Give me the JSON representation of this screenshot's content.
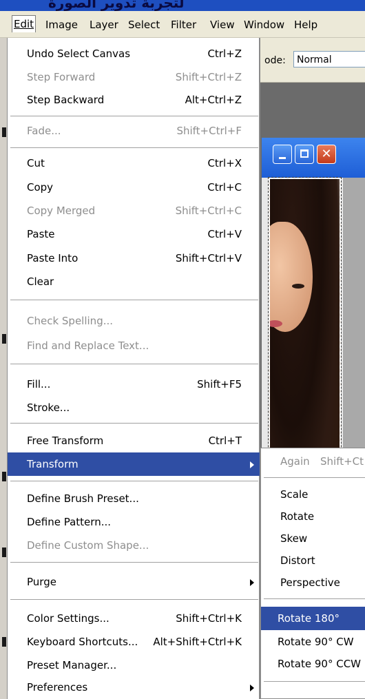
{
  "title_strip": "لتجربة تدوير الصورة",
  "menubar": [
    "Edit",
    "Image",
    "Layer",
    "Select",
    "Filter",
    "View",
    "Window",
    "Help"
  ],
  "options": {
    "mode_label": "ode:",
    "mode_value": "Normal"
  },
  "doc": {
    "close_glyph": "✕"
  },
  "edit_menu": {
    "undo": {
      "label": "Undo Select Canvas",
      "shortcut": "Ctrl+Z"
    },
    "step_forward": {
      "label": "Step Forward",
      "shortcut": "Shift+Ctrl+Z"
    },
    "step_backward": {
      "label": "Step Backward",
      "shortcut": "Alt+Ctrl+Z"
    },
    "fade": {
      "label": "Fade...",
      "shortcut": "Shift+Ctrl+F"
    },
    "cut": {
      "label": "Cut",
      "shortcut": "Ctrl+X"
    },
    "copy": {
      "label": "Copy",
      "shortcut": "Ctrl+C"
    },
    "copy_merged": {
      "label": "Copy Merged",
      "shortcut": "Shift+Ctrl+C"
    },
    "paste": {
      "label": "Paste",
      "shortcut": "Ctrl+V"
    },
    "paste_into": {
      "label": "Paste Into",
      "shortcut": "Shift+Ctrl+V"
    },
    "clear": {
      "label": "Clear"
    },
    "check_spelling": {
      "label": "Check Spelling..."
    },
    "find_replace": {
      "label": "Find and Replace Text..."
    },
    "fill": {
      "label": "Fill...",
      "shortcut": "Shift+F5"
    },
    "stroke": {
      "label": "Stroke..."
    },
    "free_transform": {
      "label": "Free Transform",
      "shortcut": "Ctrl+T"
    },
    "transform": {
      "label": "Transform"
    },
    "define_brush": {
      "label": "Define Brush Preset..."
    },
    "define_pattern": {
      "label": "Define Pattern..."
    },
    "define_shape": {
      "label": "Define Custom Shape..."
    },
    "purge": {
      "label": "Purge"
    },
    "color_settings": {
      "label": "Color Settings...",
      "shortcut": "Shift+Ctrl+K"
    },
    "keyboard_shortcuts": {
      "label": "Keyboard Shortcuts...",
      "shortcut": "Alt+Shift+Ctrl+K"
    },
    "preset_manager": {
      "label": "Preset Manager..."
    },
    "preferences": {
      "label": "Preferences"
    }
  },
  "transform_menu": {
    "again": {
      "label": "Again",
      "shortcut": "Shift+Ct"
    },
    "scale": "Scale",
    "rotate": "Rotate",
    "skew": "Skew",
    "distort": "Distort",
    "perspective": "Perspective",
    "rotate_180": "Rotate 180°",
    "rotate_90_cw": "Rotate 90° CW",
    "rotate_90_ccw": "Rotate 90° CCW"
  }
}
